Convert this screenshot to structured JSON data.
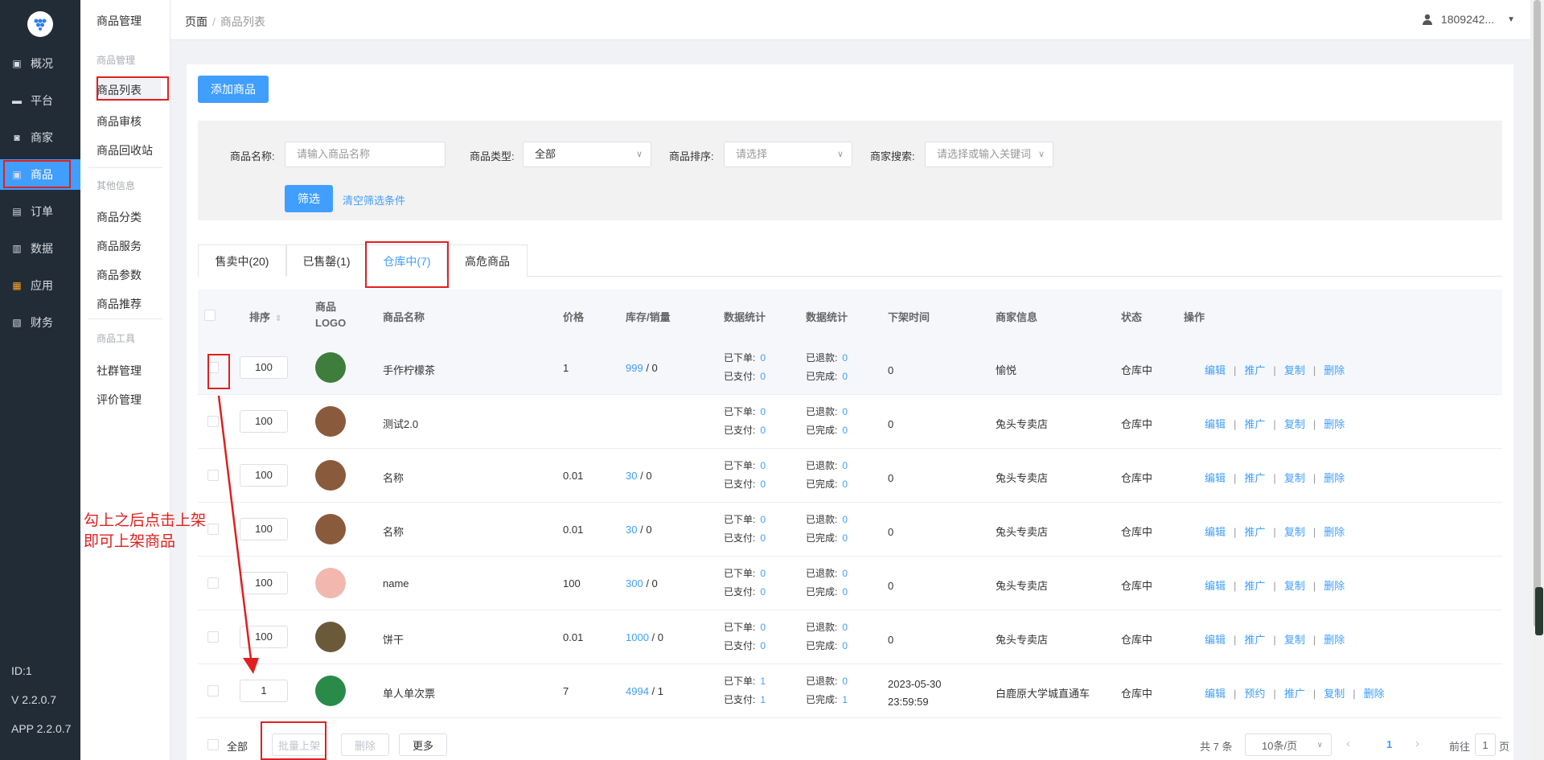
{
  "nav": {
    "items": [
      {
        "label": "概况",
        "icon": "dashboard-icon"
      },
      {
        "label": "平台",
        "icon": "monitor-icon"
      },
      {
        "label": "商家",
        "icon": "store-icon"
      },
      {
        "label": "商品",
        "icon": "goods-icon"
      },
      {
        "label": "订单",
        "icon": "order-icon"
      },
      {
        "label": "数据",
        "icon": "bar-chart-icon"
      },
      {
        "label": "应用",
        "icon": "apps-icon"
      },
      {
        "label": "财务",
        "icon": "finance-icon"
      }
    ],
    "active_index": 3,
    "footer": [
      "ID:1",
      "V 2.2.0.7",
      "APP 2.2.0.7"
    ]
  },
  "submenu": {
    "title": "商品管理",
    "group1": "商品管理",
    "items1": [
      "商品列表",
      "商品审核",
      "商品回收站"
    ],
    "group2": "其他信息",
    "items2": [
      "商品分类",
      "商品服务",
      "商品参数",
      "商品推荐"
    ],
    "group3": "商品工具",
    "items3": [
      "社群管理",
      "评价管理"
    ]
  },
  "topbar": {
    "crumb_root": "页面",
    "crumb_sep": "/",
    "crumb_current": "商品列表",
    "user": "1809242..."
  },
  "toolbar": {
    "add_label": "添加商品"
  },
  "filter": {
    "name_label": "商品名称:",
    "name_placeholder": "请输入商品名称",
    "type_label": "商品类型:",
    "type_value": "全部",
    "sort_label": "商品排序:",
    "sort_placeholder": "请选择",
    "merchant_label": "商家搜索:",
    "merchant_placeholder": "请选择或输入关键词",
    "submit_label": "筛选",
    "clear_label": "清空筛选条件"
  },
  "tabs": [
    "售卖中(20)",
    "已售罄(1)",
    "仓库中(7)",
    "高危商品"
  ],
  "active_tab": 2,
  "table": {
    "headers": [
      "排序",
      "商品LOGO",
      "商品名称",
      "价格",
      "库存/销量",
      "数据统计",
      "数据统计",
      "下架时间",
      "商家信息",
      "状态",
      "操作"
    ],
    "stat_labels": [
      "已下单:",
      "已支付:",
      "已退款:",
      "已完成:"
    ],
    "ops": [
      "编辑",
      "推广",
      "复制",
      "删除"
    ],
    "ops_last": [
      "编辑",
      "预约",
      "推广",
      "复制",
      "删除"
    ],
    "rows": [
      {
        "sort": "100",
        "name": "手作柠檬茶",
        "price": "1",
        "stock": "999",
        "sold": "0",
        "ordered": "0",
        "paid": "0",
        "refund": "0",
        "done": "0",
        "offtime": "0",
        "merchant": "愉悦",
        "status": "仓库中",
        "logo": "#3f7d3c"
      },
      {
        "sort": "100",
        "name": "测试2.0",
        "price": "",
        "stock": "",
        "sold": "",
        "ordered": "0",
        "paid": "0",
        "refund": "0",
        "done": "0",
        "offtime": "0",
        "merchant": "兔头专卖店",
        "status": "仓库中",
        "logo": "#8a5a3c"
      },
      {
        "sort": "100",
        "name": "名称",
        "price": "0.01",
        "stock": "30",
        "sold": "0",
        "ordered": "0",
        "paid": "0",
        "refund": "0",
        "done": "0",
        "offtime": "0",
        "merchant": "兔头专卖店",
        "status": "仓库中",
        "logo": "#8a5a3c"
      },
      {
        "sort": "100",
        "name": "名称",
        "price": "0.01",
        "stock": "30",
        "sold": "0",
        "ordered": "0",
        "paid": "0",
        "refund": "0",
        "done": "0",
        "offtime": "0",
        "merchant": "兔头专卖店",
        "status": "仓库中",
        "logo": "#8a5a3c"
      },
      {
        "sort": "100",
        "name": "name",
        "price": "100",
        "stock": "300",
        "sold": "0",
        "ordered": "0",
        "paid": "0",
        "refund": "0",
        "done": "0",
        "offtime": "0",
        "merchant": "兔头专卖店",
        "status": "仓库中",
        "logo": "#f2b8b0"
      },
      {
        "sort": "100",
        "name": "饼干",
        "price": "0.01",
        "stock": "1000",
        "sold": "0",
        "ordered": "0",
        "paid": "0",
        "refund": "0",
        "done": "0",
        "offtime": "0",
        "merchant": "兔头专卖店",
        "status": "仓库中",
        "logo": "#6b5a3a"
      },
      {
        "sort": "1",
        "name": "单人单次票",
        "price": "7",
        "stock": "4994",
        "sold": "1",
        "ordered": "1",
        "paid": "1",
        "refund": "0",
        "done": "1",
        "offtime": "2023-05-30 23:59:59",
        "merchant": "白鹿原大学城直通车",
        "status": "仓库中",
        "logo": "#2a8a4a"
      }
    ]
  },
  "footer": {
    "select_all": "全部",
    "batch_on": "批量上架",
    "delete": "删除",
    "more": "更多",
    "total": "共 7 条",
    "page_size": "10条/页",
    "page": "1",
    "goto_prefix": "前往",
    "goto_value": "1",
    "goto_suffix": "页"
  },
  "annotation": {
    "text_line1": "勾上之后点击上架",
    "text_line2": "即可上架商品",
    "color": "#e02020"
  }
}
